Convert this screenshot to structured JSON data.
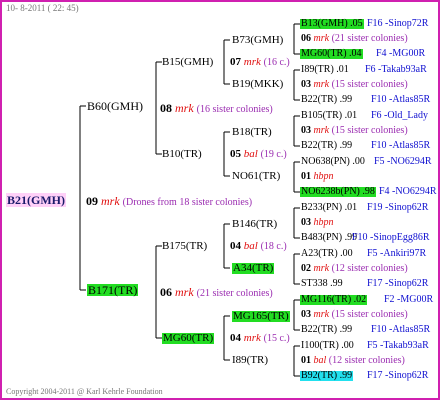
{
  "header_date": "10- 8-2011 ( 22: 45)",
  "footer": "Copyright 2004-2011 @ Karl Kehrle Foundation",
  "root": {
    "id": "B21(GMH)",
    "year": "09",
    "mark": "mrk",
    "note": "(Drones from 18 sister colonies)"
  },
  "gen1": [
    {
      "id": "B60(GMH)",
      "year": "08",
      "mark": "mrk",
      "note": "(16 sister colonies)"
    },
    {
      "id": "B171(TR)",
      "year": "06",
      "mark": "mrk",
      "note": "(21 sister colonies)"
    }
  ],
  "gen2": [
    {
      "id": "B15(GMH)",
      "year": "07",
      "mark": "mrk",
      "note": "(16 c.)"
    },
    {
      "id": "B10(TR)",
      "year": "05",
      "mark": "bal",
      "note": "(19 c.)"
    },
    {
      "id": "B175(TR)",
      "year": "04",
      "mark": "bal",
      "note": "(18 c.)"
    },
    {
      "id": "MG60(TR)",
      "year": "04",
      "mark": "mrk",
      "note": "(15 c.)"
    }
  ],
  "gen3": [
    "B73(GMH)",
    "B19(MKK)",
    "B18(TR)",
    "NO61(TR)",
    "B146(TR)",
    "A34(TR)",
    "MG165(TR)",
    "I89(TR)"
  ],
  "gen4": [
    {
      "top": "B13(GMH) .05",
      "top_code": "F16 -Sinop72R",
      "mid_year": "06",
      "mid_mark": "mrk",
      "mid_note": "(21 sister colonies)",
      "bot": "MG60(TR) .04",
      "bot_code": "F4 -MG00R"
    },
    {
      "top": "I89(TR) .01",
      "top_code": "F6 -Takab93aR",
      "mid_year": "03",
      "mid_mark": "mrk",
      "mid_note": "(15 sister colonies)",
      "bot": "B22(TR) .99",
      "bot_code": "F10 -Atlas85R"
    },
    {
      "top": "B105(TR) .01",
      "top_code": "F6 -Old_Lady",
      "mid_year": "03",
      "mid_mark": "mrk",
      "mid_note": "(15 sister colonies)",
      "bot": "B22(TR) .99",
      "bot_code": "F10 -Atlas85R"
    },
    {
      "top": "NO638(PN) .00",
      "top_code": "F5 -NO6294R",
      "mid_year": "01",
      "mid_mark": "hbpn",
      "mid_note": "",
      "bot": "NO6238b(PN) .98",
      "bot_code": "F4 -NO6294R"
    },
    {
      "top": "B233(PN) .01",
      "top_code": "F19 -Sinop62R",
      "mid_year": "03",
      "mid_mark": "hbpn",
      "mid_note": "",
      "bot": "B483(PN) .99",
      "bot_code": "F10 -SinopEgg86R"
    },
    {
      "top": "A23(TR) .00",
      "top_code": "F5 -Ankiri97R",
      "mid_year": "02",
      "mid_mark": "mrk",
      "mid_note": "(12 sister colonies)",
      "bot": "ST338 .99",
      "bot_code": "F17 -Sinop62R"
    },
    {
      "top": "MG116(TR) .02",
      "top_code": "F2 -MG00R",
      "mid_year": "03",
      "mid_mark": "mrk",
      "mid_note": "(15 sister colonies)",
      "bot": "B22(TR) .99",
      "bot_code": "F10 -Atlas85R"
    },
    {
      "top": "I100(TR) .00",
      "top_code": "F5 -Takab93aR",
      "mid_year": "01",
      "mid_mark": "bal",
      "mid_note": "(12 sister colonies)",
      "bot": "B92(TR) .99",
      "bot_code": "F17 -Sinop62R"
    }
  ],
  "colors": {
    "frame": "#d020b0",
    "line": "#000000",
    "green": "#22dd22",
    "cyan": "#22e0ee",
    "magenta_bg": "#ffd0f8",
    "mark_red": "#e01010",
    "note_purple": "#9a2bb0",
    "code_blue": "#1010d0"
  }
}
